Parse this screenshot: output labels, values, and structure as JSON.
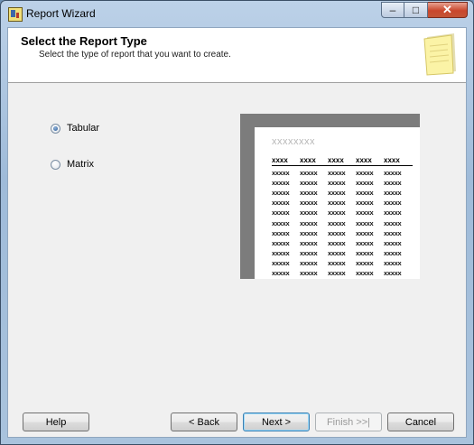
{
  "window": {
    "title": "Report Wizard",
    "controls": {
      "minimize": "–",
      "maximize": "□",
      "close": "✕"
    }
  },
  "header": {
    "title": "Select the Report Type",
    "subtitle": "Select the type of report that you want to create.",
    "icon": "note-icon"
  },
  "report_types": [
    {
      "label": "Tabular",
      "checked": true
    },
    {
      "label": "Matrix",
      "checked": false
    }
  ],
  "preview": {
    "title": "xxxxxxxx",
    "headers": [
      "xxxx",
      "xxxx",
      "xxxx",
      "xxxx",
      "xxxx"
    ],
    "rows": [
      [
        "xxxxx",
        "xxxxx",
        "xxxxx",
        "xxxxx",
        "xxxxx"
      ],
      [
        "xxxxx",
        "xxxxx",
        "xxxxx",
        "xxxxx",
        "xxxxx"
      ],
      [
        "xxxxx",
        "xxxxx",
        "xxxxx",
        "xxxxx",
        "xxxxx"
      ],
      [
        "xxxxx",
        "xxxxx",
        "xxxxx",
        "xxxxx",
        "xxxxx"
      ],
      [
        "xxxxx",
        "xxxxx",
        "xxxxx",
        "xxxxx",
        "xxxxx"
      ],
      [
        "xxxxx",
        "xxxxx",
        "xxxxx",
        "xxxxx",
        "xxxxx"
      ],
      [
        "xxxxx",
        "xxxxx",
        "xxxxx",
        "xxxxx",
        "xxxxx"
      ],
      [
        "xxxxx",
        "xxxxx",
        "xxxxx",
        "xxxxx",
        "xxxxx"
      ],
      [
        "xxxxx",
        "xxxxx",
        "xxxxx",
        "xxxxx",
        "xxxxx"
      ],
      [
        "xxxxx",
        "xxxxx",
        "xxxxx",
        "xxxxx",
        "xxxxx"
      ],
      [
        "xxxxx",
        "xxxxx",
        "xxxxx",
        "xxxxx",
        "xxxxx"
      ]
    ]
  },
  "buttons": {
    "help": "Help",
    "back": "< Back",
    "next": "Next >",
    "finish": "Finish >>|",
    "cancel": "Cancel"
  },
  "colors": {
    "title_bar": "#a9c3dd",
    "close_button": "#c9472d",
    "preview_frame": "#7c7c7c"
  }
}
